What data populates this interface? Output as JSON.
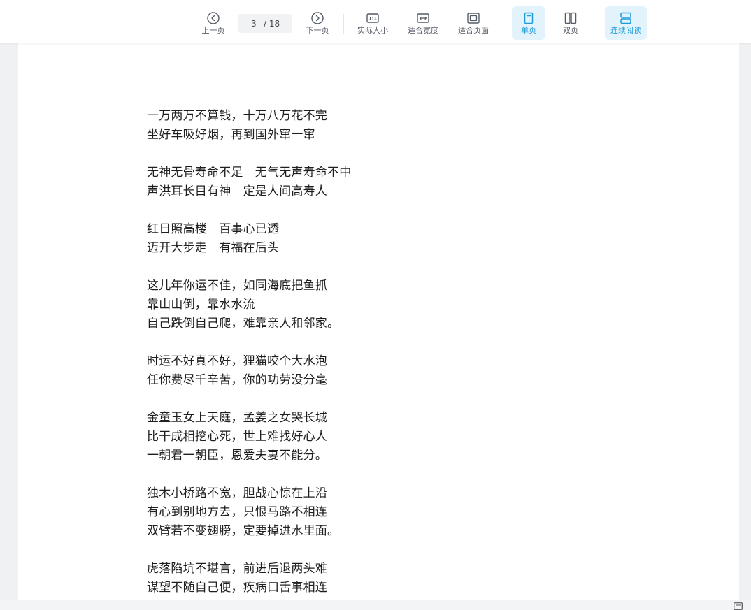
{
  "toolbar": {
    "prev_label": "上一页",
    "next_label": "下一页",
    "current_page": "3",
    "total_pages": "/ 18",
    "actual_size_label": "实际大小",
    "fit_width_label": "适合宽度",
    "fit_page_label": "适合页面",
    "single_page_label": "单页",
    "double_page_label": "双页",
    "continuous_label": "连续阅读",
    "accent_color": "#1b9bd8",
    "icons": {
      "prev": "chevron-left-circle-icon",
      "next": "chevron-right-circle-icon",
      "actual_size": "one-to-one-icon",
      "fit_width": "fit-width-icon",
      "fit_page": "fit-page-icon",
      "single": "single-page-icon",
      "double": "double-page-icon",
      "continuous": "continuous-scroll-icon"
    }
  },
  "document": {
    "lines": [
      "一万两万不算钱，十万八万花不完",
      "坐好车吸好烟，再到国外窜一窜",
      "",
      "无神无骨寿命不足　无气无声寿命不中",
      "声洪耳长目有神　定是人间高寿人",
      "",
      "红日照高楼　百事心已透",
      "迈开大步走　有福在后头",
      "",
      "这儿年你运不佳，如同海底把鱼抓",
      "靠山山倒，靠水水流",
      "自己跌倒自己爬，难靠亲人和邻家。",
      "",
      "时运不好真不好，狸猫咬个大水泡",
      "任你费尽千辛苦，你的功劳没分毫",
      "",
      "金童玉女上天庭，孟姜之女哭长城",
      "比干成相挖心死，世上难找好心人",
      "一朝君一朝臣，恩爱夫妻不能分。",
      "",
      "独木小桥路不宽，胆战心惊在上沿",
      "有心到别地方去，只恨马路不相连",
      "双臂若不变翅膀，定要掉进水里面。",
      "",
      "虎落陷坑不堪言，前进后退两头难",
      "谋望不随自己便，疾病口舌事相连"
    ]
  },
  "statusbar": {
    "icon": "note-icon"
  }
}
